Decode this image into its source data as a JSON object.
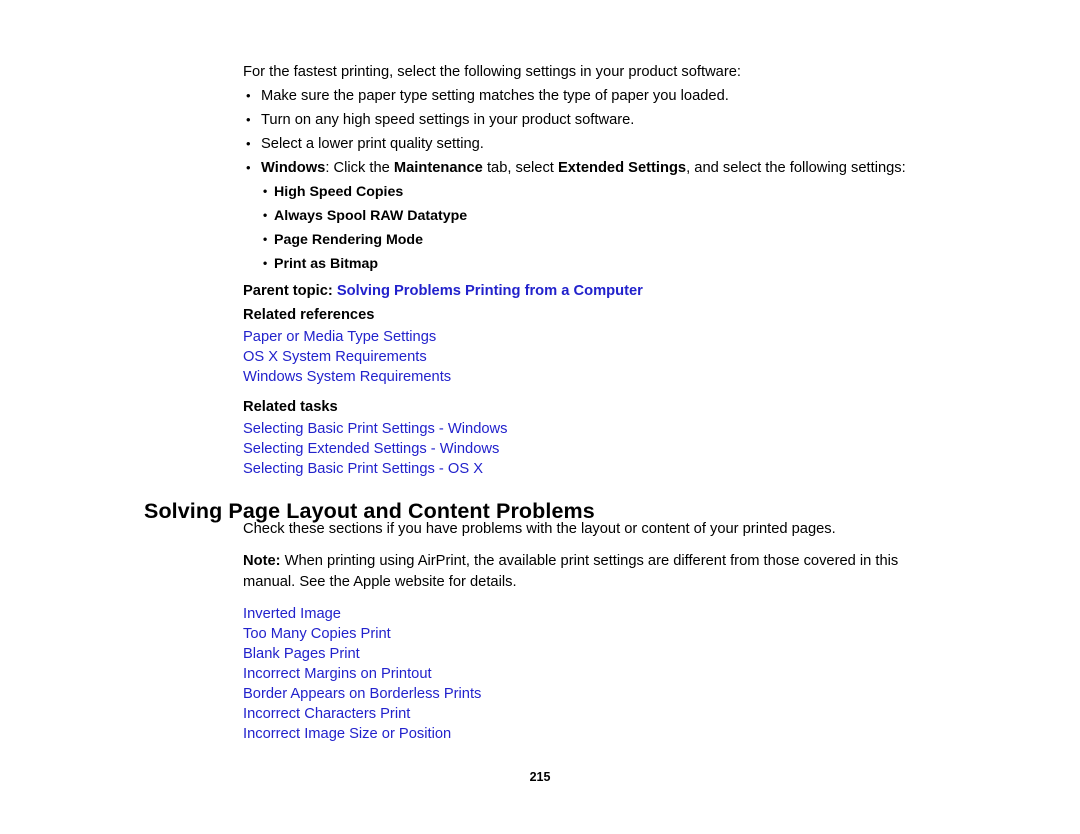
{
  "document": {
    "intro_paragraph": "For the fastest printing, select the following settings in your product software:",
    "bullets": [
      {
        "text": "Make sure the paper type setting matches the type of paper you loaded."
      },
      {
        "text": "Turn on any high speed settings in your product software."
      },
      {
        "text": "Select a lower print quality setting."
      }
    ],
    "windows_bullet": {
      "label": "Windows",
      "text_1": ": Click the ",
      "bold_1": "Maintenance",
      "text_2": " tab, select ",
      "bold_2": "Extended Settings",
      "text_3": ", and select the following settings:"
    },
    "sub_bullets": [
      "High Speed Copies",
      "Always Spool RAW Datatype",
      "Page Rendering Mode",
      "Print as Bitmap"
    ],
    "parent_topic": {
      "label": "Parent topic:",
      "link": "Solving Problems Printing from a Computer"
    },
    "related_references": {
      "heading": "Related references",
      "links": [
        "Paper or Media Type Settings",
        "OS X System Requirements",
        "Windows System Requirements"
      ]
    },
    "related_tasks": {
      "heading": "Related tasks",
      "links": [
        "Selecting Basic Print Settings - Windows",
        "Selecting Extended Settings - Windows",
        "Selecting Basic Print Settings - OS X"
      ]
    },
    "section_heading": "Solving Page Layout and Content Problems",
    "section_intro": "Check these sections if you have problems with the layout or content of your printed pages.",
    "note": {
      "label": "Note:",
      "text": " When printing using AirPrint, the available print settings are different from those covered in this manual. See the Apple website for details."
    },
    "toc_links": [
      "Inverted Image",
      "Too Many Copies Print",
      "Blank Pages Print",
      "Incorrect Margins on Printout",
      "Border Appears on Borderless Prints",
      "Incorrect Characters Print",
      "Incorrect Image Size or Position"
    ],
    "page_number": "215"
  },
  "colors": {
    "link": "#2222CC",
    "text": "#000000",
    "background": "#FFFFFF"
  }
}
